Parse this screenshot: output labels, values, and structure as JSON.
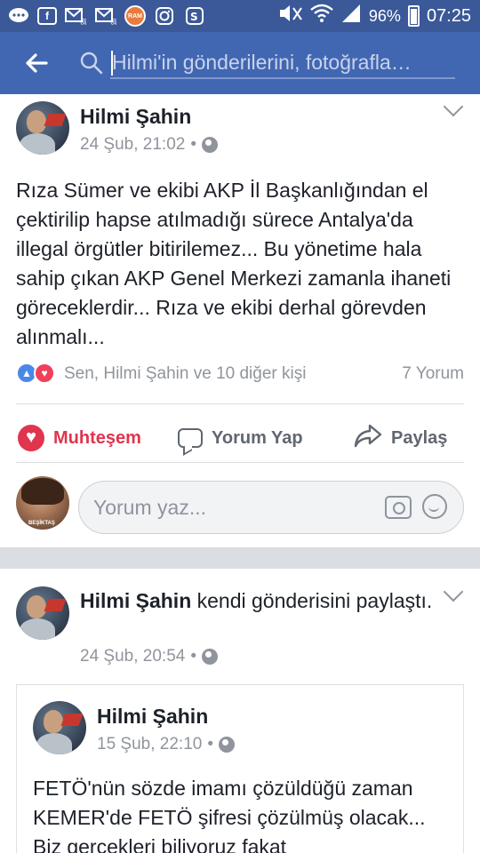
{
  "status_bar": {
    "battery": "96%",
    "time": "07:25",
    "ram_label": "RAM",
    "icons_left": [
      "messenger-icon",
      "facebook-icon",
      "mail-icon",
      "mail-icon",
      "ram-booster-icon",
      "instagram-icon",
      "shopping-icon"
    ],
    "icons_right": [
      "mute-icon",
      "wifi-icon",
      "signal-icon",
      "battery-icon"
    ]
  },
  "header": {
    "search_placeholder": "Hilmi'in gönderilerini, fotoğrafla…"
  },
  "posts": [
    {
      "author": "Hilmi Şahin",
      "time": "24 Şub, 21:02",
      "separator": "•",
      "text": "Rıza Sümer ve ekibi AKP İl Başkanlığından el çektirilip hapse atılmadığı sürece Antalya'da illegal örgütler bitirilemez... Bu yönetime hala sahip çıkan AKP Genel Merkezi zamanla ihaneti göreceklerdir... Rıza ve ekibi derhal görevden alınmalı...",
      "reactions_text": "Sen, Hilmi Şahin ve 10 diğer kişi",
      "comments_count": "7 Yorum",
      "actions": {
        "love": "Muhteşem",
        "comment": "Yorum Yap",
        "share": "Paylaş"
      },
      "comment_placeholder": "Yorum yaz...",
      "commenter_tag": "BEŞİKTAŞ"
    },
    {
      "author": "Hilmi Şahin",
      "author_suffix": "kendi gönderisini paylaştı.",
      "time": "24 Şub, 20:54",
      "separator": "•",
      "shared": {
        "author": "Hilmi Şahin",
        "time": "15 Şub, 22:10",
        "separator": "•",
        "text": "FETÖ'nün sözde imamı çözüldüğü zaman KEMER'de FETÖ şifresi çözülmüş olacak... Biz gerçekleri biliyoruz fakat"
      }
    }
  ],
  "colors": {
    "status_bar": "#3b5998",
    "header": "#4267b2",
    "love": "#e0354d",
    "like": "#4a88e8"
  }
}
